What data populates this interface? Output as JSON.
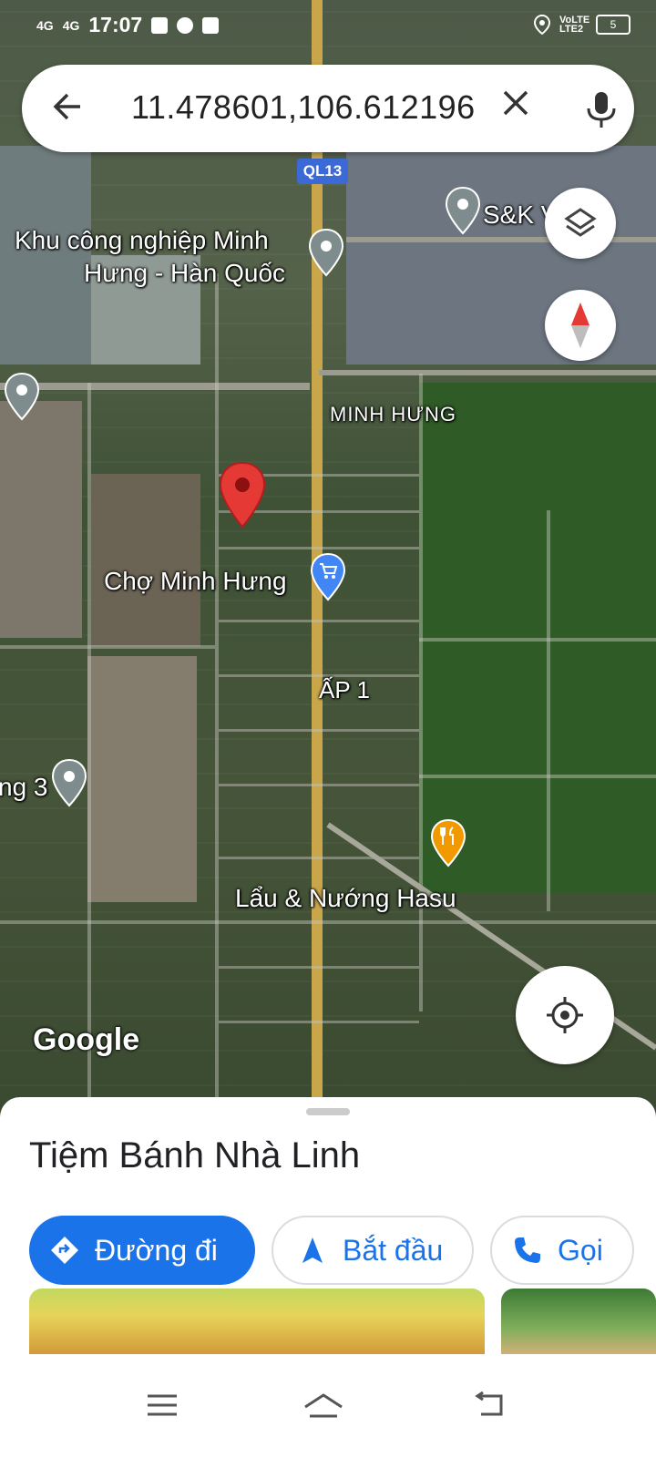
{
  "status_bar": {
    "signal1": "4G",
    "signal2": "4G",
    "time": "17:07",
    "network": "VoLTE LTE2",
    "battery": "5"
  },
  "search": {
    "query": "11.478601,106.612196",
    "back_icon": "arrow-left-icon",
    "clear_icon": "close-icon",
    "mic_icon": "mic-icon"
  },
  "map": {
    "labels": {
      "road_shield": "QL13",
      "sk": "S&K V",
      "khu_line1": "Khu công nghiệp Minh",
      "khu_line2": "Hưng - Hàn Quốc",
      "minh_hung": "MINH HƯNG",
      "cho": "Chợ Minh Hưng",
      "ap1": "ẤP 1",
      "ng3": "ng 3",
      "lau": "Lẩu & Nướng Hasu",
      "google": "Google"
    },
    "colors": {
      "selected_pin": "#e53935",
      "shopping_pin": "#4285f4",
      "restaurant_pin": "#f29900",
      "place_pin": "#9aa0a6"
    }
  },
  "place_sheet": {
    "title": "Tiệm Bánh Nhà Linh",
    "buttons": {
      "directions": "Đường đi",
      "start": "Bắt đầu",
      "call": "Gọi"
    },
    "accent": "#1a73e8"
  }
}
